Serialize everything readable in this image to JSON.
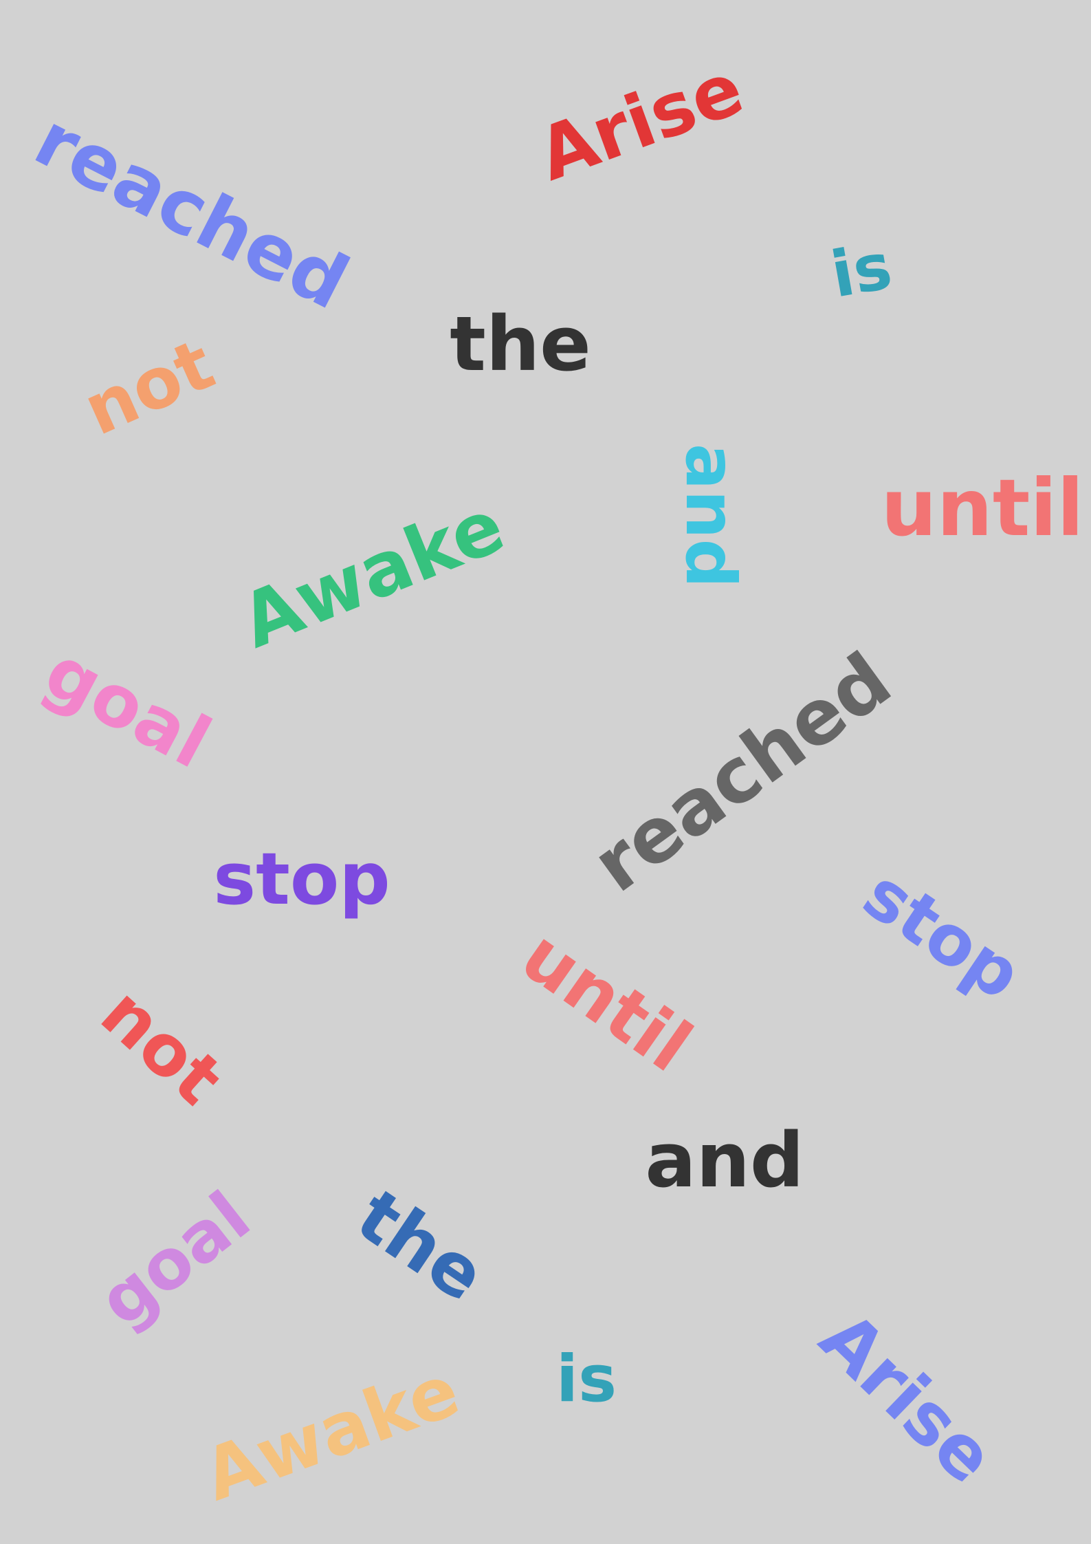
{
  "background": "#d2d2d2",
  "words": [
    {
      "text": "reached",
      "color": "#7585f2"
    },
    {
      "text": "Arise",
      "color": "#e23636"
    },
    {
      "text": "is",
      "color": "#33a2b8"
    },
    {
      "text": "the",
      "color": "#333333"
    },
    {
      "text": "not",
      "color": "#f4a06e"
    },
    {
      "text": "and",
      "color": "#3ec5e0"
    },
    {
      "text": "until",
      "color": "#f27474"
    },
    {
      "text": "Awake",
      "color": "#36c27e"
    },
    {
      "text": "goal",
      "color": "#f285cb"
    },
    {
      "text": "reached",
      "color": "#666666"
    },
    {
      "text": "stop",
      "color": "#7d4ae0"
    },
    {
      "text": "stop",
      "color": "#7585f2"
    },
    {
      "text": "until",
      "color": "#f27474"
    },
    {
      "text": "not",
      "color": "#f05656"
    },
    {
      "text": "and",
      "color": "#333333"
    },
    {
      "text": "goal",
      "color": "#cf89e0"
    },
    {
      "text": "the",
      "color": "#356bb5"
    },
    {
      "text": "is",
      "color": "#33a2b8"
    },
    {
      "text": "Arise",
      "color": "#7585f2"
    },
    {
      "text": "Awake",
      "color": "#f5c27e"
    }
  ]
}
